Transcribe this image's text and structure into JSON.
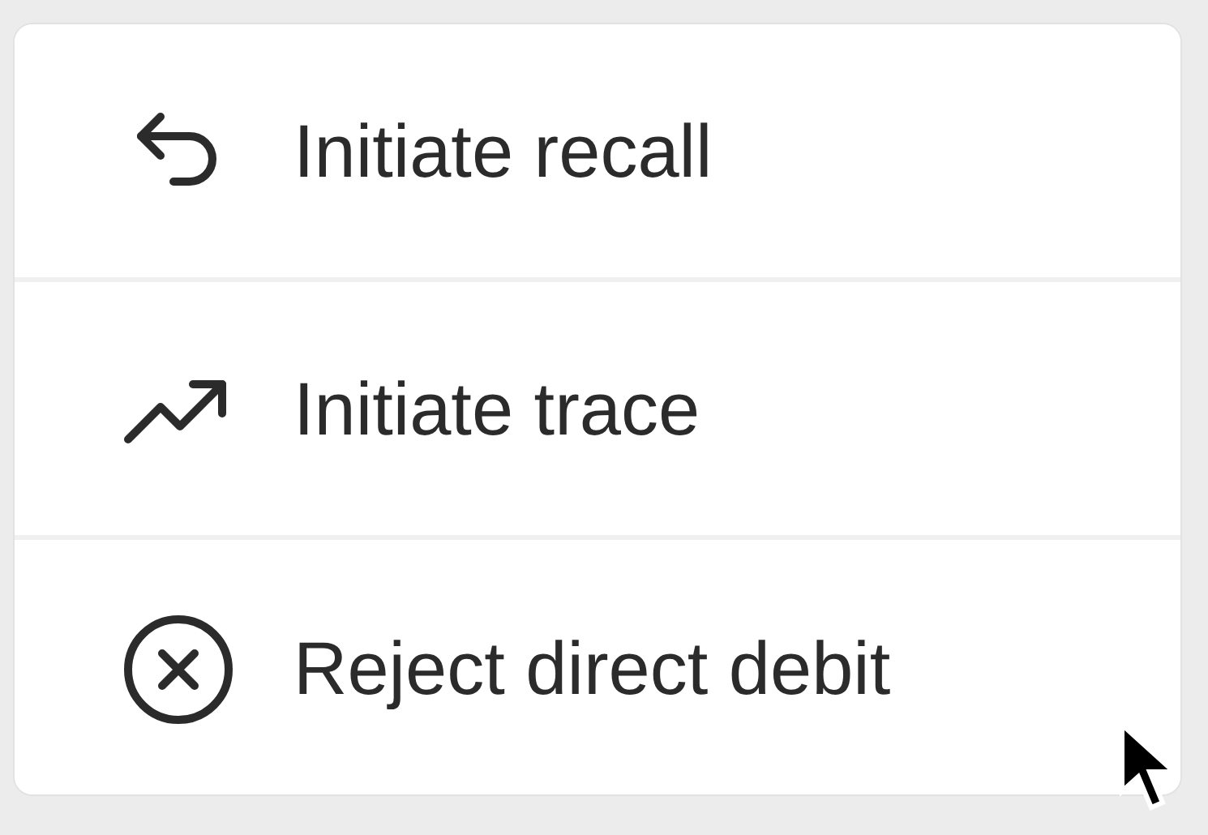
{
  "menu": {
    "items": [
      {
        "kind": "recall",
        "label": "Initiate recall"
      },
      {
        "kind": "trace",
        "label": "Initiate trace"
      },
      {
        "kind": "reject",
        "label": "Reject direct debit"
      }
    ]
  }
}
